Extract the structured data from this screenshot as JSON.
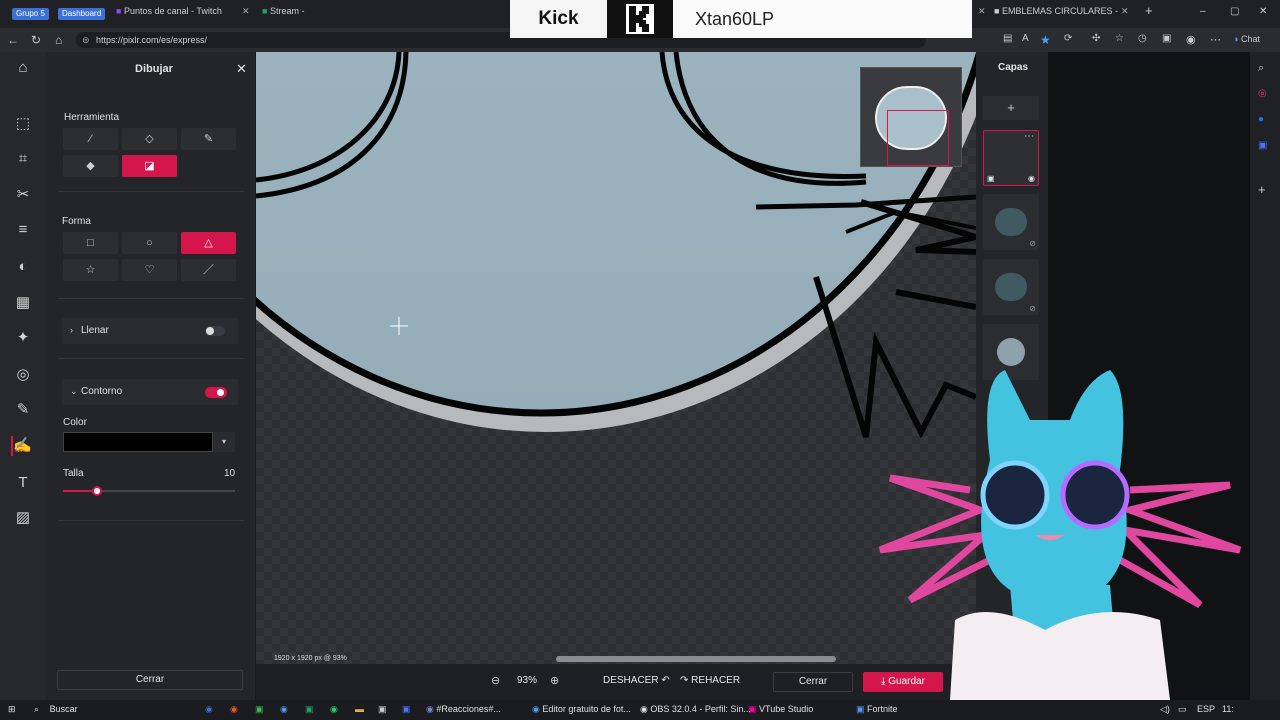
{
  "browser": {
    "tabs": [
      {
        "label": "Grupo 5",
        "color": "#3b6fd6"
      },
      {
        "label": "Dashboard",
        "color": "#3b6fd6"
      },
      {
        "label": "Puntos de canal - Twitch"
      },
      {
        "label": "Stream -"
      },
      {
        "label": "EMBLEMAS CIRCULARES - Bús"
      }
    ],
    "url": "https://pixlr.com/es/express/",
    "chat_label": "Chat"
  },
  "kick": {
    "brand": "Kick",
    "username": "Xtan60LP"
  },
  "draw_panel": {
    "title": "Dibujar",
    "tool_section": "Herramienta",
    "shape_section": "Forma",
    "fill_label": "Llenar",
    "outline_label": "Contorno",
    "color_label": "Color",
    "color_value": "#000000",
    "size_label": "Talla",
    "size_value": "10",
    "size_fraction": 0.2,
    "close_label": "Cerrar"
  },
  "canvas": {
    "dimensions_label": "1920 x 1920 px @ 93%"
  },
  "bottombar": {
    "zoom": "93%",
    "undo": "DESHACER",
    "redo": "REHACER",
    "close": "Cerrar",
    "save": "Guardar"
  },
  "layers": {
    "title": "Capas"
  },
  "taskbar": {
    "search": "Buscar",
    "items": [
      "#Reacciones#...",
      "Editor gratuito de fot...",
      "OBS 32.0.4 - Perfil: Sin...",
      "VTube Studio",
      "Fortnite"
    ],
    "lang": "ESP",
    "time": "11:"
  },
  "colors": {
    "accent": "#d5164d",
    "panel": "#232528"
  }
}
